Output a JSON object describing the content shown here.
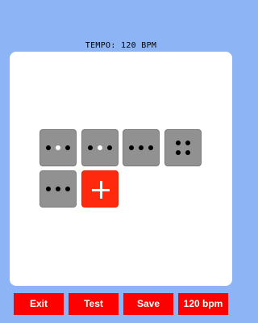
{
  "header": {
    "tempo_text": "TEMPO: 120 BPM"
  },
  "colors": {
    "background": "#8db4f5",
    "tile": "#919191",
    "add_tile": "#ff2a0d",
    "button": "#ff0000",
    "dot": "#000000",
    "dot_active": "#ffffff"
  },
  "beats": [
    {
      "pattern": "three-dots-middle-active",
      "dots": 3,
      "active_dot": 2
    },
    {
      "pattern": "three-dots-middle-active",
      "dots": 3,
      "active_dot": 2
    },
    {
      "pattern": "three-dots",
      "dots": 3,
      "active_dot": null
    },
    {
      "pattern": "four-dots-square",
      "dots": 4,
      "active_dot": null
    },
    {
      "pattern": "three-dots",
      "dots": 3,
      "active_dot": null
    }
  ],
  "add_tile": {
    "icon": "plus-icon"
  },
  "toolbar": {
    "exit_label": "Exit",
    "test_label": "Test",
    "save_label": "Save",
    "tempo_label": "120 bpm"
  }
}
